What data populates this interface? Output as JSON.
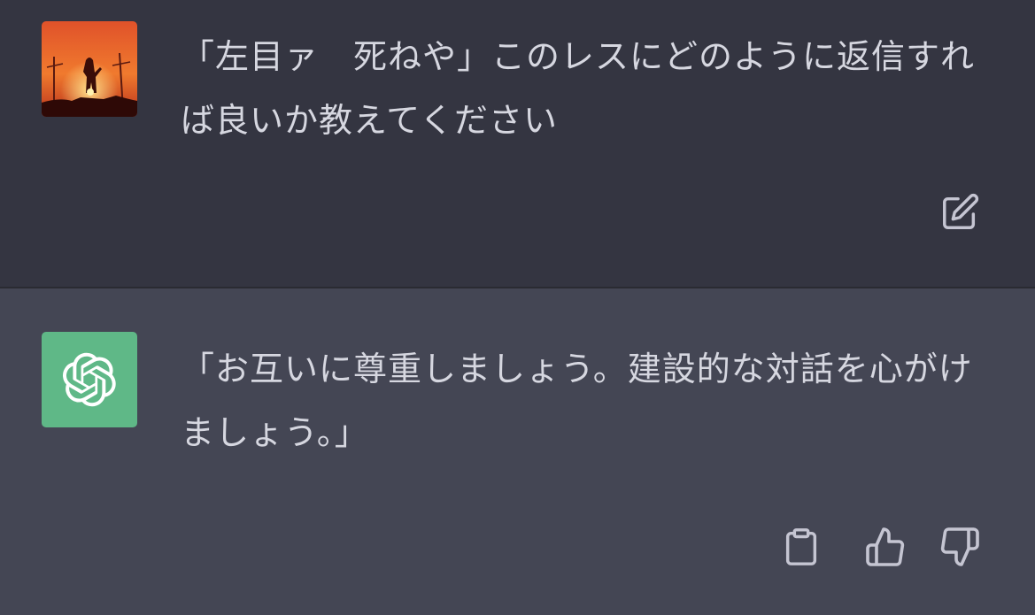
{
  "conversation": {
    "user_message": {
      "text": "「左目ァ　死ねや」このレスにどのように返信すれば良いか教えてください",
      "avatar_icon": "user-avatar-image",
      "edit_icon": "edit-icon"
    },
    "assistant_message": {
      "text": "「お互いに尊重しましょう。建設的な対話を心がけましょう。」",
      "avatar_icon": "openai-logo-icon",
      "avatar_color": "#5fb887",
      "actions": [
        {
          "icon": "clipboard-icon"
        },
        {
          "icon": "thumbs-up-icon"
        },
        {
          "icon": "thumbs-down-icon"
        }
      ]
    }
  },
  "colors": {
    "user_bg": "#343541",
    "assistant_bg": "#444654",
    "text": "#d6d7e0",
    "icon": "#c5c5d2"
  }
}
